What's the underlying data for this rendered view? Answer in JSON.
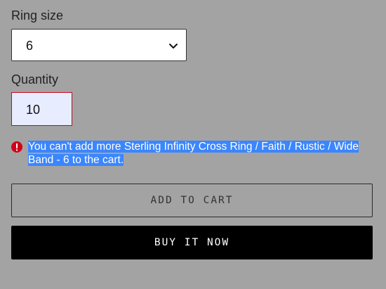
{
  "ring_size": {
    "label": "Ring size",
    "selected_value": "6"
  },
  "quantity": {
    "label": "Quantity",
    "value": "10"
  },
  "error": {
    "message": "You can't add more Sterling Infinity Cross Ring / Faith / Rustic / Wide Band - 6 to the cart.",
    "color": "#d0021b",
    "highlight_color": "#3a86ff"
  },
  "buttons": {
    "add_to_cart": "ADD TO CART",
    "buy_it_now": "BUY IT NOW"
  },
  "icons": {
    "select_chevron": "chevron-down-icon",
    "error": "error-icon"
  }
}
